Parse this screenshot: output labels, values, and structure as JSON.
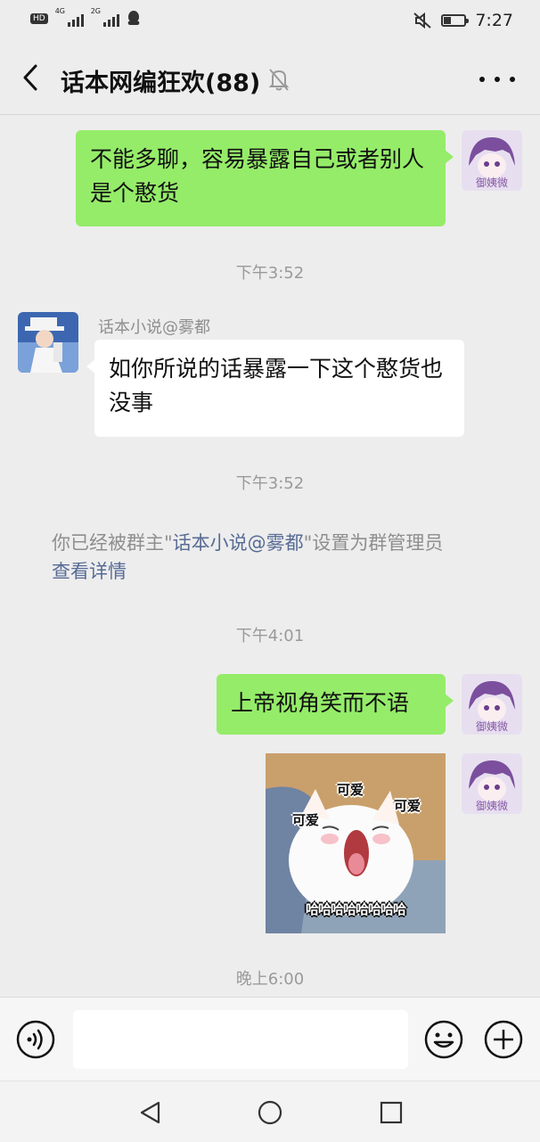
{
  "status_bar": {
    "hd": "HD",
    "sim1": "4G",
    "sim2": "2G",
    "time": "7:27",
    "battery_level": 0.35
  },
  "header": {
    "title": "话本网编狂欢(88)",
    "muted": true
  },
  "messages": [
    {
      "type": "out",
      "text": "不能多聊，容易暴露自己或者别人是个憨货",
      "avatar": "self-avatar"
    },
    {
      "type": "time",
      "text": "下午3:52"
    },
    {
      "type": "in",
      "sender": "话本小说@雾都",
      "text": "如你所说的话暴露一下这个憨货也没事",
      "avatar": "sender-avatar"
    },
    {
      "type": "time",
      "text": "下午3:52"
    },
    {
      "type": "system",
      "prefix": "你已经被群主\"",
      "name": "话本小说@雾都",
      "suffix": "\"设置为群管理员",
      "link": "查看详情"
    },
    {
      "type": "time",
      "text": "下午4:01"
    },
    {
      "type": "out",
      "text": "上帝视角笑而不语",
      "avatar": "self-avatar"
    },
    {
      "type": "sticker",
      "labels": [
        "可爱",
        "可爱",
        "可爱"
      ],
      "caption": "哈哈哈哈哈哈哈哈",
      "avatar": "self-avatar"
    },
    {
      "type": "time",
      "text": "晚上6:00"
    }
  ],
  "self_avatar_text": "御姨微",
  "input": {
    "placeholder": ""
  },
  "colors": {
    "background": "#ededed",
    "bubble_out": "#95ec69",
    "bubble_in": "#ffffff",
    "link": "#576b95"
  },
  "icons": {
    "back": "chevron-left-icon",
    "mute": "bell-off-icon",
    "more": "more-dots-icon",
    "voice": "voice-icon",
    "emoji": "smiley-icon",
    "plus": "plus-circle-icon",
    "nav_back": "triangle-back-icon",
    "nav_home": "circle-home-icon",
    "nav_recent": "square-recent-icon"
  }
}
